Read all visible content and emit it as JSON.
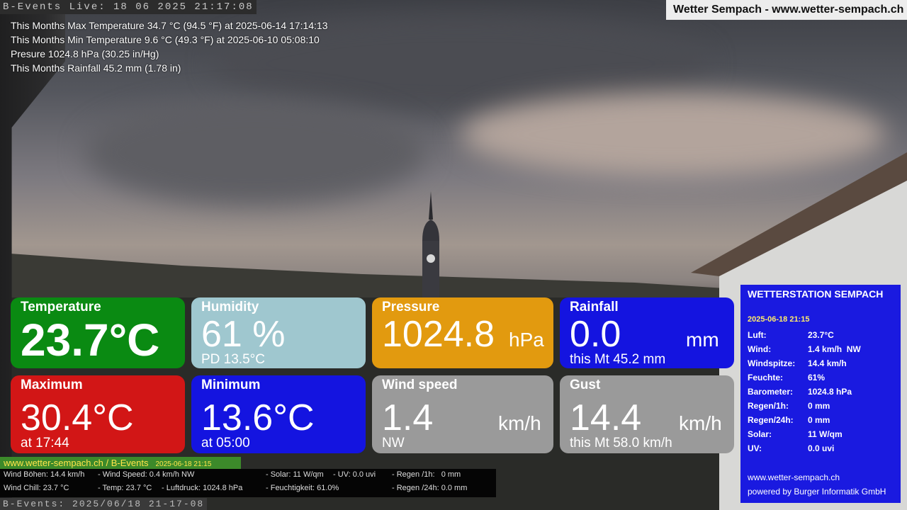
{
  "banner_top": "B-Events Live: 18 06 2025 21:17:08",
  "site_title": "Wetter Sempach - www.wetter-sempach.ch",
  "stats": [
    "This Months Max Temperature 34.7 °C (94.5 °F) at 2025-06-14 17:14:13",
    "This Months Min Temperature 9.6 °C (49.3 °F) at 2025-06-10 05:08:10",
    "Presure 1024.8 hPa (30.25 in/Hg)",
    "This Months Rainfall 45.2 mm (1.78 in)"
  ],
  "tiles": {
    "temperature": {
      "title": "Temperature",
      "value": "23.7°C",
      "color": "#0a8a12"
    },
    "humidity": {
      "title": "Humidity",
      "value": "61 %",
      "sub": "PD 13.5°C",
      "color": "#9fc7cf"
    },
    "pressure": {
      "title": "Pressure",
      "value": "1024.8",
      "unit": "hPa",
      "color": "#e29a0f"
    },
    "rainfall": {
      "title": "Rainfall",
      "value": "0.0",
      "unit": "mm",
      "sub": "this Mt 45.2 mm",
      "color": "#1414e0"
    },
    "maximum": {
      "title": "Maximum",
      "value": "30.4°C",
      "sub": "at 17:44",
      "color": "#d21616"
    },
    "minimum": {
      "title": "Minimum",
      "value": "13.6°C",
      "sub": "at 05:00",
      "color": "#1414e0"
    },
    "wind": {
      "title": "Wind speed",
      "value": "1.4",
      "unit": "km/h",
      "sub": "NW",
      "color": "#9a9a9a"
    },
    "gust": {
      "title": "Gust",
      "value": "14.4",
      "unit": "km/h",
      "sub": "this Mt 58.0 km/h",
      "color": "#9a9a9a"
    }
  },
  "station": {
    "title": "WETTERSTATION SEMPACH",
    "date": "2025-06-18 21:15",
    "rows": [
      {
        "k": "Luft:",
        "v": "23.7°C"
      },
      {
        "k": "Wind:",
        "v": "1.4 km/h  NW"
      },
      {
        "k": "Windspitze:",
        "v": "14.4 km/h"
      },
      {
        "k": "Feuchte:",
        "v": "61%"
      },
      {
        "k": "Barometer:",
        "v": "1024.8 hPa"
      },
      {
        "k": "Regen/1h:",
        "v": "0 mm"
      },
      {
        "k": "Regen/24h:",
        "v": "0 mm"
      },
      {
        "k": "Solar:",
        "v": "11 W/qm"
      },
      {
        "k": "UV:",
        "v": "0.0 uvi"
      }
    ],
    "footer_url": "www.wetter-sempach.ch",
    "footer_credit": "powered by Burger Informatik GmbH"
  },
  "bottom": {
    "site_strip": "www.wetter-sempach.ch / B-Events",
    "site_strip_date": "2025-06-18 21:15",
    "ticker": [
      "Wind Böhen: 14.4 km/h",
      "- Wind Speed: 0.4 km/h NW",
      "- Solar: 11 W/qm",
      "- UV: 0.0 uvi",
      "- Regen /1h:   0 mm",
      "Wind Chill: 23.7 °C",
      "- Temp: 23.7 °C",
      "- Luftdruck: 1024.8 hPa",
      "- Feuchtigkeit: 61.0%",
      "- Regen /24h: 0.0 mm"
    ],
    "banner_bottom": "B-Events: 2025/06/18 21-17-08"
  }
}
